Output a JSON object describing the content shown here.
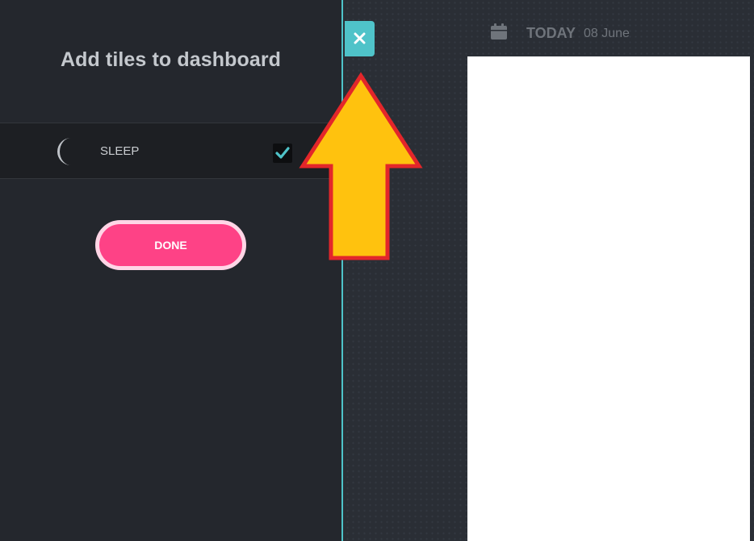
{
  "panel": {
    "title": "Add tiles to dashboard",
    "tiles": [
      {
        "label": "SLEEP",
        "icon": "moon-icon",
        "checked": true
      }
    ],
    "done_label": "DONE"
  },
  "close_button": {
    "icon": "close-icon"
  },
  "dashboard": {
    "today_label": "TODAY",
    "date": "08 June",
    "icon": "calendar-icon"
  },
  "colors": {
    "accent": "#4fc3c9",
    "done": "#fe4286",
    "annotation_fill": "#ffc20e",
    "annotation_stroke": "#e3262a"
  }
}
